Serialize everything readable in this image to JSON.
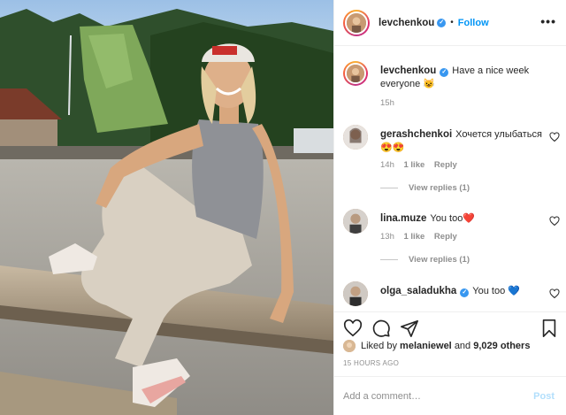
{
  "post": {
    "author": {
      "username": "levchenkou",
      "verified": true,
      "follow_label": "Follow",
      "more_icon": "more-horizontal-icon"
    },
    "caption": {
      "username": "levchenkou",
      "text": "Have a nice week everyone 😺",
      "time": "15h"
    },
    "comments": [
      {
        "username": "gerashchenkoi",
        "text": "Хочется улыбаться 😍😍",
        "time": "14h",
        "likes_label": "1 like",
        "reply_label": "Reply",
        "view_replies": "View replies (1)"
      },
      {
        "username": "lina.muze",
        "text": "You too❤️",
        "time": "13h",
        "likes_label": "1 like",
        "reply_label": "Reply",
        "view_replies": "View replies (1)"
      },
      {
        "username": "olga_saladukha",
        "verified": true,
        "text": "You too 💙"
      }
    ],
    "likes": {
      "prefix": "Liked by",
      "liker": "melaniewel",
      "conjunction": "and",
      "count_label": "9,029 others"
    },
    "timestamp": "15 HOURS AGO",
    "add_comment": {
      "placeholder": "Add a comment…",
      "post_label": "Post"
    },
    "colors": {
      "accent": "#0095f6",
      "post_disabled": "#b2dffc",
      "verified": "#3897f0",
      "muted_text": "#8e8e8e"
    },
    "icons": [
      "heart-icon",
      "comment-icon",
      "share-icon",
      "bookmark-icon",
      "heart-outline-icon"
    ]
  }
}
